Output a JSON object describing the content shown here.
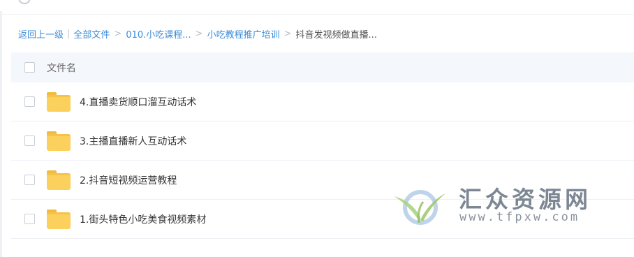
{
  "breadcrumb": {
    "back": "返回上一级",
    "separator": "|",
    "path": [
      "全部文件",
      "010.小吃课程...",
      "小吃教程推广培训"
    ],
    "arrow": ">",
    "current": "抖音发视频做直播..."
  },
  "list": {
    "header_label": "文件名",
    "items": [
      {
        "name": "4.直播卖货顺口溜互动话术",
        "type": "folder"
      },
      {
        "name": "3.主播直播新人互动话术",
        "type": "folder"
      },
      {
        "name": "2.抖音短视频运营教程",
        "type": "folder"
      },
      {
        "name": "1.街头特色小吃美食视频素材",
        "type": "folder"
      }
    ]
  },
  "watermark": {
    "title": "汇众资源网",
    "url": "www.tfpxw.com",
    "logo_icon": "sprout-leaf-icon"
  },
  "colors": {
    "link": "#3b8cda",
    "header_bg": "#f4f7fc",
    "folder": "#fcd05c",
    "watermark_text": "#7d8794"
  }
}
